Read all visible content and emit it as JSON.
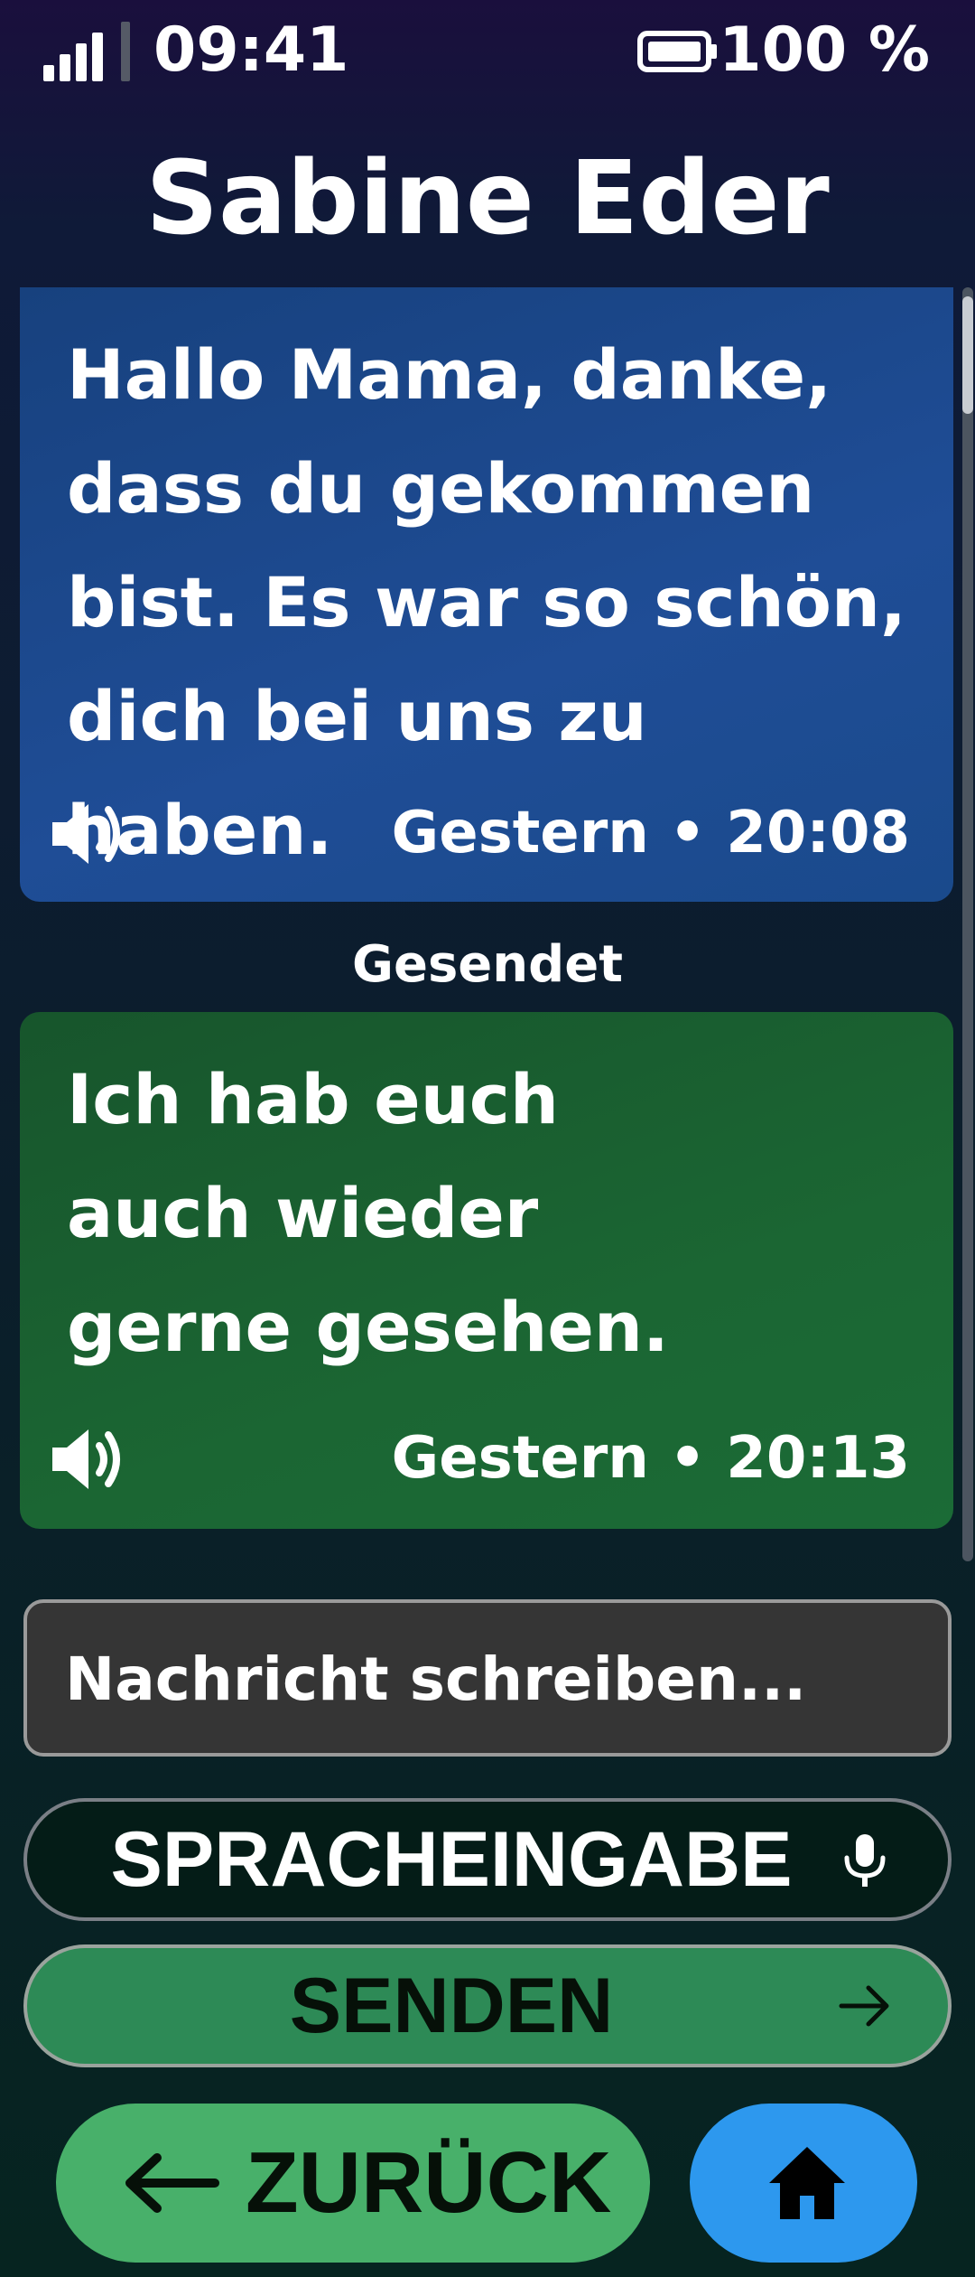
{
  "status_bar": {
    "time": "09:41",
    "battery": "100 %",
    "signal_icon": "signal-icon",
    "battery_icon": "battery-icon"
  },
  "header": {
    "title": "Sabine Eder"
  },
  "messages": [
    {
      "type": "received",
      "text": "Hallo Mama, danke, dass du gekommen bist. Es war so schön, dich bei uns zu haben.",
      "timestamp": "Gestern • 20:08",
      "icon": "speaker-icon",
      "color": "#1f4d96"
    },
    {
      "type": "sent",
      "text": "Ich hab euch\nauch wieder\ngerne gesehen.",
      "timestamp": "Gestern • 20:13",
      "icon": "speaker-icon",
      "color": "#1b6633"
    }
  ],
  "sent_label": "Gesendet",
  "compose": {
    "placeholder": "Nachricht schreiben...",
    "value": ""
  },
  "buttons": {
    "voice_input": "SPRACHEINGABE",
    "voice_icon": "microphone-icon",
    "send": "SENDEN",
    "send_icon": "arrow-right-icon",
    "back": "ZURÜCK",
    "back_icon": "arrow-left-icon",
    "home_icon": "home-icon"
  },
  "colors": {
    "send_button": "#2d8a56",
    "back_button": "#48b06a",
    "home_button": "#2d98ee"
  }
}
